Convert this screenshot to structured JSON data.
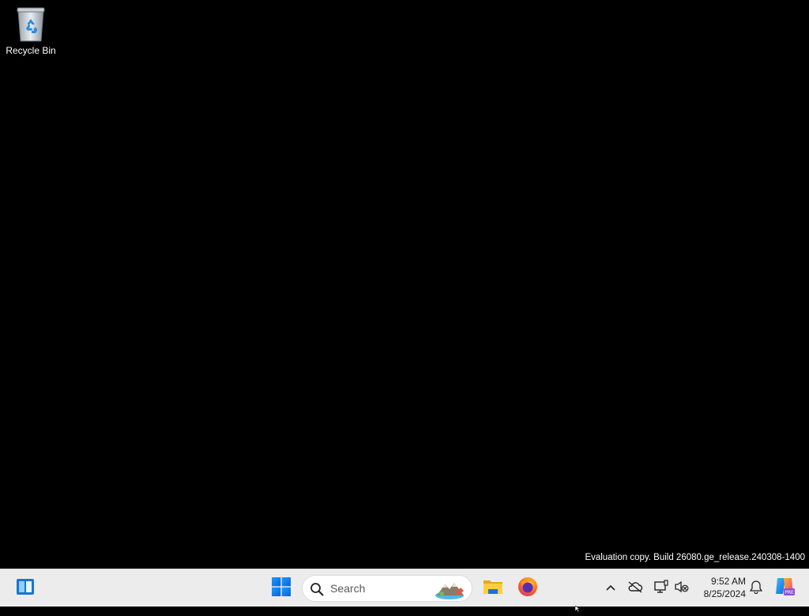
{
  "desktop": {
    "icons": [
      {
        "label": "Recycle Bin",
        "icon": "recycle-bin-icon"
      }
    ],
    "watermark": "Evaluation copy. Build 26080.ge_release.240308-1400"
  },
  "taskbar": {
    "widgets_icon": "widgets-icon",
    "start_icon": "windows-start-icon",
    "search": {
      "placeholder": "Search",
      "icon": "search-icon"
    },
    "pinned": [
      {
        "name": "File Explorer",
        "icon": "folder-icon"
      },
      {
        "name": "Firefox",
        "icon": "firefox-icon"
      }
    ],
    "tray": {
      "icons": [
        "chevron-up-icon",
        "onedrive-off-icon",
        "network-icon",
        "volume-muted-icon",
        "notification-bell-icon",
        "copilot-icon"
      ],
      "time": "9:52 AM",
      "date": "8/25/2024"
    }
  },
  "colors": {
    "desktop_bg": "#000000",
    "taskbar_bg": "#ececec",
    "windows_blue": "#1e90ff"
  }
}
